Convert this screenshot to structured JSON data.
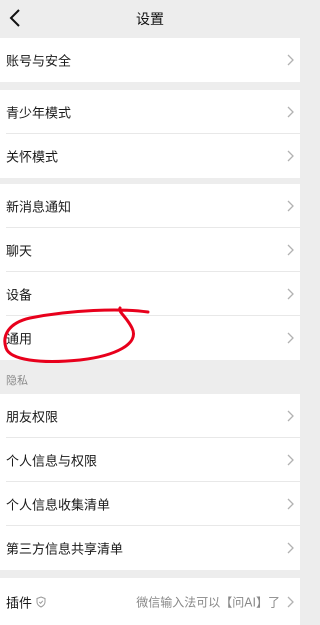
{
  "header": {
    "title": "设置"
  },
  "groups": {
    "account": {
      "items": [
        {
          "label": "账号与安全"
        }
      ]
    },
    "mode": {
      "items": [
        {
          "label": "青少年模式"
        },
        {
          "label": "关怀模式"
        }
      ]
    },
    "general": {
      "items": [
        {
          "label": "新消息通知"
        },
        {
          "label": "聊天"
        },
        {
          "label": "设备"
        },
        {
          "label": "通用"
        }
      ]
    },
    "privacy": {
      "section_label": "隐私",
      "items": [
        {
          "label": "朋友权限"
        },
        {
          "label": "个人信息与权限"
        },
        {
          "label": "个人信息收集清单"
        },
        {
          "label": "第三方信息共享清单"
        }
      ]
    },
    "plugin": {
      "label": "插件",
      "value": "微信输入法可以【问AI】了"
    }
  },
  "colors": {
    "background": "#ededed",
    "card": "#ffffff",
    "annotation": "#e8001c"
  },
  "icons": {
    "back": "chevron-left-icon",
    "row": "chevron-right-icon",
    "plugin": "shield-icon"
  }
}
